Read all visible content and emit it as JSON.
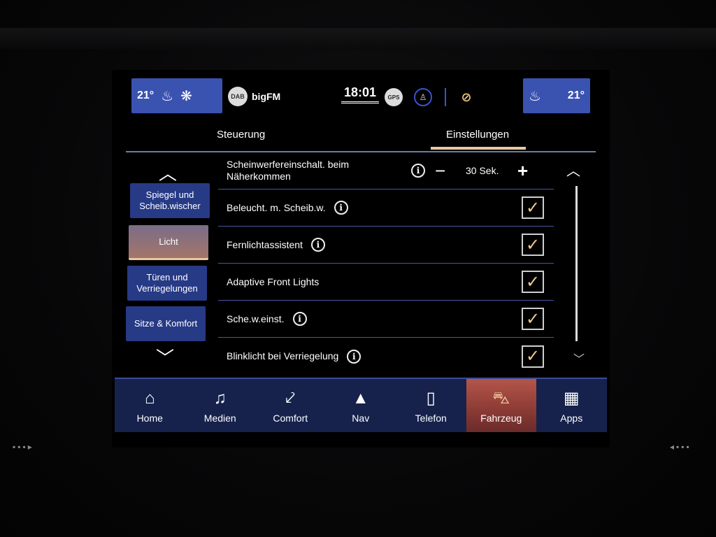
{
  "status": {
    "temp_left": "21°",
    "temp_right": "21°",
    "dab_label": "DAB",
    "station": "bigFM",
    "time": "18:01",
    "gps_label": "GPS"
  },
  "tabs": [
    {
      "label": "Steuerung",
      "active": false
    },
    {
      "label": "Einstellungen",
      "active": true
    }
  ],
  "categories": [
    {
      "label": "Spiegel und Scheib.wischer",
      "active": false
    },
    {
      "label": "Licht",
      "active": true
    },
    {
      "label": "Türen und Verriegelungen",
      "active": false
    },
    {
      "label": "Sitze & Komfort",
      "active": false
    }
  ],
  "settings": {
    "headlight_delay": {
      "label": "Scheinwerfereinschalt. beim Näherkommen",
      "value": "30 Sek.",
      "minus": "−",
      "plus": "+"
    },
    "rows": [
      {
        "label": "Beleucht. m. Scheib.w.",
        "checked": true,
        "has_info": true
      },
      {
        "label": "Fernlichtassistent",
        "checked": true,
        "has_info": true
      },
      {
        "label": "Adaptive Front Lights",
        "checked": true,
        "has_info": false
      },
      {
        "label": "Sche.w.einst.",
        "checked": true,
        "has_info": true
      },
      {
        "label": "Blinklicht bei Verriegelung",
        "checked": true,
        "has_info": true
      }
    ]
  },
  "bottom_nav": [
    {
      "label": "Home",
      "icon": "home-icon",
      "glyph": "⌂",
      "active": false
    },
    {
      "label": "Medien",
      "icon": "music-note-icon",
      "glyph": "♫",
      "active": false
    },
    {
      "label": "Comfort",
      "icon": "seat-icon",
      "glyph": "⤦",
      "active": false
    },
    {
      "label": "Nav",
      "icon": "compass-icon",
      "glyph": "▲",
      "active": false
    },
    {
      "label": "Telefon",
      "icon": "phone-icon",
      "glyph": "▯",
      "active": false
    },
    {
      "label": "Fahrzeug",
      "icon": "car-icon",
      "glyph": "⛍",
      "active": true
    },
    {
      "label": "Apps",
      "icon": "apps-grid-icon",
      "glyph": "▦",
      "active": false
    }
  ],
  "colors": {
    "accent_blue": "#273a86",
    "active_tab_underline": "#e7c9a2",
    "check_color": "#f0c88e",
    "active_nav": "#b4554a"
  }
}
